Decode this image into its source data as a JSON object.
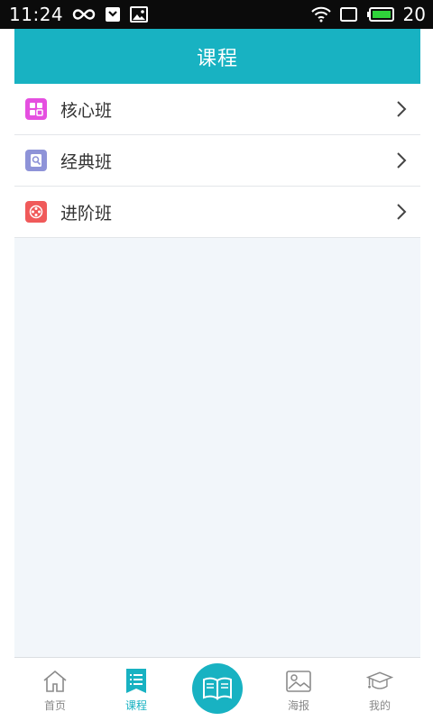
{
  "status_bar": {
    "time": "11:24",
    "battery_level": "20",
    "icons": [
      "infinity-icon",
      "shield-icon",
      "image-icon",
      "wifi-icon",
      "sim-icon",
      "battery-icon"
    ]
  },
  "header": {
    "title": "课程"
  },
  "courses": [
    {
      "label": "核心班",
      "icon": "grid-icon",
      "color": "#e54fe0"
    },
    {
      "label": "经典班",
      "icon": "search-doc-icon",
      "color": "#8e93d8"
    },
    {
      "label": "进阶班",
      "icon": "film-reel-icon",
      "color": "#f05a5a"
    }
  ],
  "tabs": [
    {
      "label": "首页",
      "icon": "home-icon",
      "active": false
    },
    {
      "label": "课程",
      "icon": "list-icon",
      "active": true
    },
    {
      "label": "",
      "icon": "book-icon",
      "active": false
    },
    {
      "label": "海报",
      "icon": "picture-icon",
      "active": false
    },
    {
      "label": "我的",
      "icon": "graduation-cap-icon",
      "active": false
    }
  ],
  "colors": {
    "accent": "#18b2c2",
    "background": "#f2f6fa",
    "status_bar": "#0b0b0b"
  }
}
